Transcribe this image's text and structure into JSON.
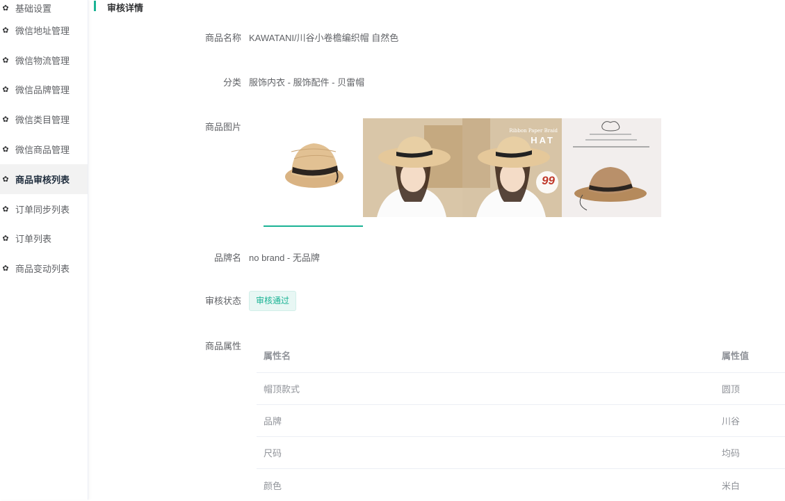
{
  "sidebar": {
    "items": [
      {
        "label": "基础设置",
        "icon": "gear-icon"
      },
      {
        "label": "微信地址管理",
        "icon": "gear-icon"
      },
      {
        "label": "微信物流管理",
        "icon": "gear-icon"
      },
      {
        "label": "微信品牌管理",
        "icon": "gear-icon"
      },
      {
        "label": "微信类目管理",
        "icon": "gear-icon"
      },
      {
        "label": "微信商品管理",
        "icon": "gear-icon"
      },
      {
        "label": "商品审核列表",
        "icon": "gear-icon",
        "active": true
      },
      {
        "label": "订单同步列表",
        "icon": "gear-icon"
      },
      {
        "label": "订单列表",
        "icon": "gear-icon"
      },
      {
        "label": "商品变动列表",
        "icon": "gear-icon"
      }
    ]
  },
  "header": {
    "title": "审核详情",
    "accent": "#1ab394"
  },
  "detail": {
    "name_label": "商品名称",
    "name_value": "KAWATANI/川谷小卷檐编织帽 自然色",
    "category_label": "分类",
    "category_value": "服饰内衣 - 服饰配件 - 贝雷帽",
    "images_label": "商品图片",
    "brand_label": "品牌名",
    "brand_value": "no brand - 无品牌",
    "status_label": "审核状态",
    "status_value": "审核通过",
    "attrs_label": "商品属性"
  },
  "images": {
    "img2_caption": "HAT",
    "img2_brand": "Ribbon Paper Braid",
    "img2_price": "99"
  },
  "attributes": {
    "col_name": "属性名",
    "col_value": "属性值",
    "rows": [
      {
        "name": "帽顶款式",
        "value": "圆顶"
      },
      {
        "name": "品牌",
        "value": "川谷"
      },
      {
        "name": "尺码",
        "value": "均码"
      },
      {
        "name": "颜色",
        "value": "米白"
      }
    ]
  }
}
